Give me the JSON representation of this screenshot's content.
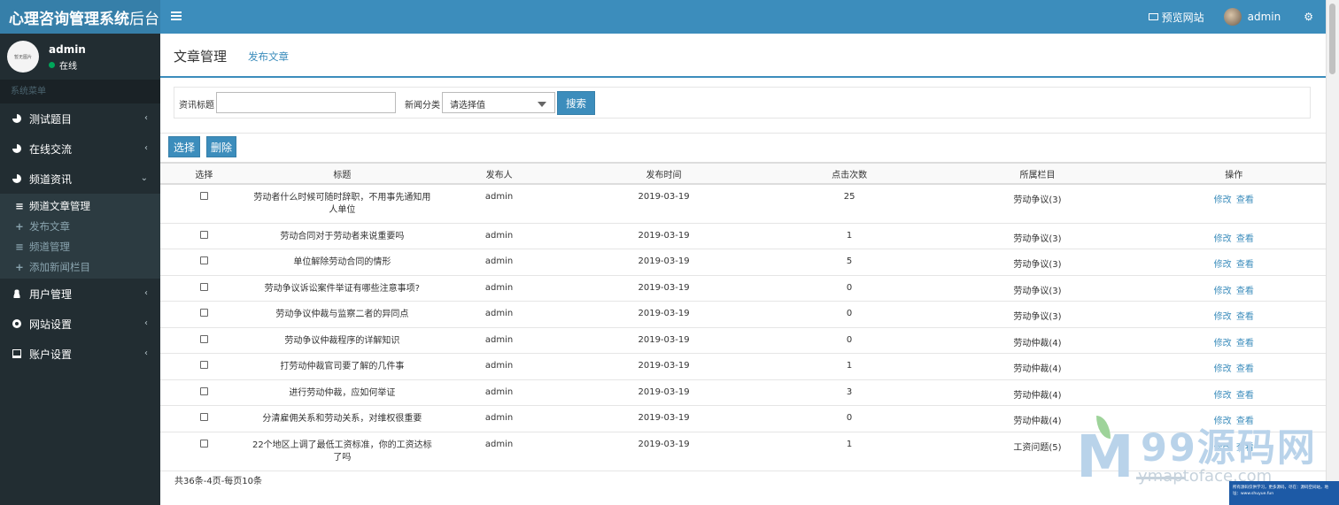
{
  "brand": {
    "main": "心理咨询管理系统",
    "lite": "后台"
  },
  "topbar": {
    "preview": "预览网站",
    "user": "admin"
  },
  "sidebar": {
    "avatar_text": "暂无图片",
    "user_name": "admin",
    "status": "在线",
    "header": "系统菜单",
    "items": [
      {
        "label": "测试题目"
      },
      {
        "label": "在线交流"
      },
      {
        "label": "频道资讯"
      },
      {
        "label": "用户管理"
      },
      {
        "label": "网站设置"
      },
      {
        "label": "账户设置"
      }
    ],
    "sub_items": [
      {
        "label": "频道文章管理"
      },
      {
        "label": "发布文章"
      },
      {
        "label": "频道管理"
      },
      {
        "label": "添加新闻栏目"
      }
    ]
  },
  "page": {
    "title": "文章管理",
    "link": "发布文章"
  },
  "search": {
    "title_label": "资讯标题",
    "title_value": "",
    "category_label": "新闻分类",
    "category_value": "请选择值",
    "button": "搜索"
  },
  "toolbar": {
    "choose": "选择",
    "delete": "删除"
  },
  "table": {
    "columns": [
      "选择",
      "标题",
      "发布人",
      "发布时间",
      "点击次数",
      "所属栏目",
      "操作"
    ],
    "edit_label": "修改",
    "view_label": "查看",
    "rows": [
      {
        "title": "劳动者什么时候可随时辞职，不用事先通知用人单位",
        "author": "admin",
        "date": "2019-03-19",
        "clicks": "25",
        "category": "劳动争议(3)"
      },
      {
        "title": "劳动合同对于劳动者来说重要吗",
        "author": "admin",
        "date": "2019-03-19",
        "clicks": "1",
        "category": "劳动争议(3)"
      },
      {
        "title": "单位解除劳动合同的情形",
        "author": "admin",
        "date": "2019-03-19",
        "clicks": "5",
        "category": "劳动争议(3)"
      },
      {
        "title": "劳动争议诉讼案件举证有哪些注意事项?",
        "author": "admin",
        "date": "2019-03-19",
        "clicks": "0",
        "category": "劳动争议(3)"
      },
      {
        "title": "劳动争议仲裁与监察二者的异同点",
        "author": "admin",
        "date": "2019-03-19",
        "clicks": "0",
        "category": "劳动争议(3)"
      },
      {
        "title": "劳动争议仲裁程序的详解知识",
        "author": "admin",
        "date": "2019-03-19",
        "clicks": "0",
        "category": "劳动仲裁(4)"
      },
      {
        "title": "打劳动仲裁官司要了解的几件事",
        "author": "admin",
        "date": "2019-03-19",
        "clicks": "1",
        "category": "劳动仲裁(4)"
      },
      {
        "title": "进行劳动仲裁，应如何举证",
        "author": "admin",
        "date": "2019-03-19",
        "clicks": "3",
        "category": "劳动仲裁(4)"
      },
      {
        "title": "分清雇佣关系和劳动关系，对维权很重要",
        "author": "admin",
        "date": "2019-03-19",
        "clicks": "0",
        "category": "劳动仲裁(4)"
      },
      {
        "title": "22个地区上调了最低工资标准，你的工资达标了吗",
        "author": "admin",
        "date": "2019-03-19",
        "clicks": "1",
        "category": "工资问题(5)"
      }
    ]
  },
  "pager": "共36条-4页-每页10条",
  "watermark": {
    "logo_text": "99源码网",
    "url": "ymaptoface.com",
    "box_text": "所有源码仅供学习，更多源码，尽在：源码空间站，地址：www.shuyue.fun"
  }
}
